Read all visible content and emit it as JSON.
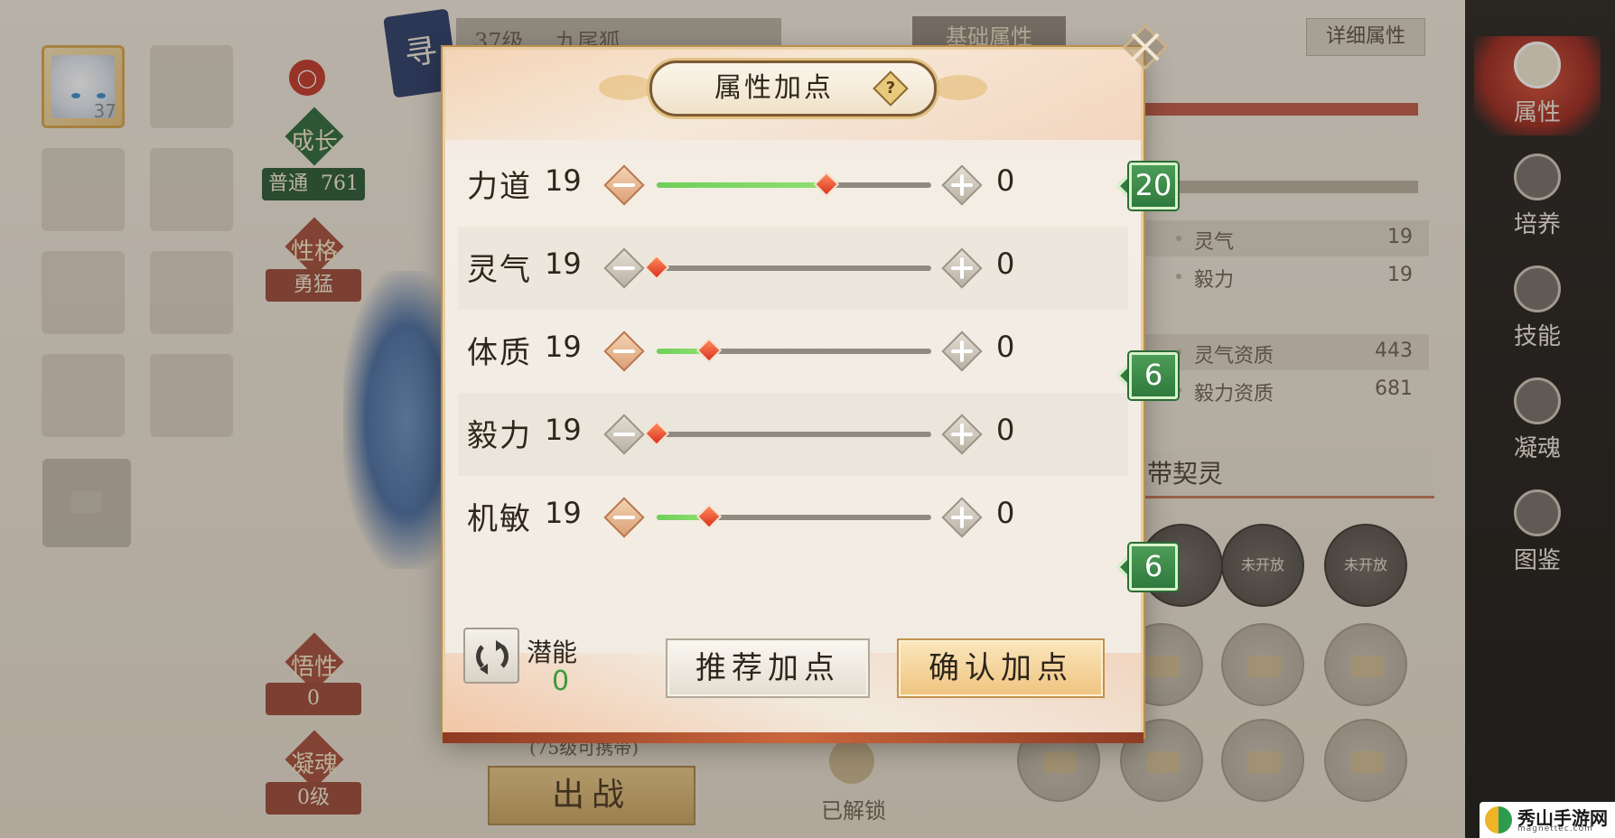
{
  "background": {
    "pet_level": "37",
    "pet_name_bar": {
      "level": "37级",
      "name": "九尾狐"
    },
    "tab_basic": "基础属性",
    "detail_button": "详细属性",
    "growth": {
      "title": "成长",
      "rank": "普通",
      "value": "761"
    },
    "personality": {
      "title": "性格",
      "value": "勇猛"
    },
    "savvy": {
      "title": "悟性",
      "value": "0"
    },
    "soul_condense": {
      "title": "凝魂",
      "value": "0级"
    },
    "stats": [
      {
        "label": "灵气",
        "value": "19"
      },
      {
        "label": "毅力",
        "value": "19"
      },
      {
        "label": "灵气资质",
        "value": "443"
      },
      {
        "label": "毅力资质",
        "value": "681"
      }
    ],
    "contract_title": "带契灵",
    "locked_slot_label": "未开放",
    "carry_note": "(75级可携带)",
    "fight_button": "出战",
    "unlocked_label": "已解锁"
  },
  "right_nav": [
    {
      "label": "属性",
      "icon": "paw-icon",
      "active": true
    },
    {
      "label": "培养",
      "icon": "nurture-icon",
      "active": false
    },
    {
      "label": "技能",
      "icon": "scroll-icon",
      "active": false
    },
    {
      "label": "凝魂",
      "icon": "soul-icon",
      "active": false
    },
    {
      "label": "图鉴",
      "icon": "book-icon",
      "active": false
    }
  ],
  "modal": {
    "title": "属性加点",
    "help": "?",
    "attributes": [
      {
        "name": "力道",
        "base": "19",
        "added": "0",
        "slider_fraction": 0.62,
        "minus_enabled": true,
        "recommended": "20"
      },
      {
        "name": "灵气",
        "base": "19",
        "added": "0",
        "slider_fraction": 0.0,
        "minus_enabled": false,
        "recommended": null
      },
      {
        "name": "体质",
        "base": "19",
        "added": "0",
        "slider_fraction": 0.19,
        "minus_enabled": true,
        "recommended": "6"
      },
      {
        "name": "毅力",
        "base": "19",
        "added": "0",
        "slider_fraction": 0.0,
        "minus_enabled": false,
        "recommended": null
      },
      {
        "name": "机敏",
        "base": "19",
        "added": "0",
        "slider_fraction": 0.19,
        "minus_enabled": true,
        "recommended": "6"
      }
    ],
    "potential_label": "潜能",
    "potential_value": "0",
    "recommend_button": "推荐加点",
    "confirm_button": "确认加点"
  },
  "watermark": {
    "text": "秀山手游网",
    "sub": "magnettec.com"
  },
  "colors": {
    "slider_fill": "#6fcf59",
    "thumb": "#d9321e",
    "badge": "#2f7a3d",
    "active_nav": "#9c2a20"
  }
}
